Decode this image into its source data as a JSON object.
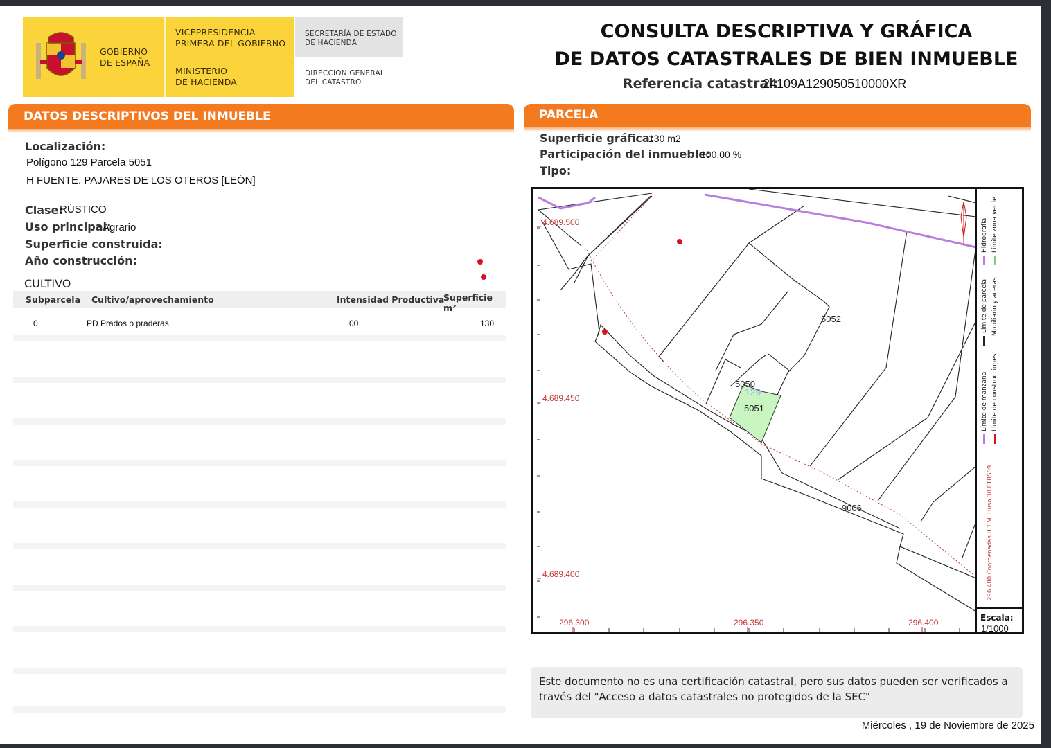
{
  "header": {
    "gov_line1": "GOBIERNO",
    "gov_line2": "DE ESPAÑA",
    "vice_line1": "VICEPRESIDENCIA",
    "vice_line2": "PRIMERA DEL GOBIERNO",
    "min_line1": "MINISTERIO",
    "min_line2": "DE HACIENDA",
    "sec_line1": "SECRETARÍA DE ESTADO",
    "sec_line2": "DE HACIENDA",
    "dir_line1": "DIRECCIÓN GENERAL",
    "dir_line2": "DEL CATASTRO"
  },
  "title": {
    "line1": "CONSULTA DESCRIPTIVA Y GRÁFICA",
    "line2": "DE DATOS CATASTRALES DE BIEN INMUEBLE",
    "ref_label": "Referencia catastral:",
    "ref_value": "24109A129050510000XR"
  },
  "left": {
    "header": "DATOS DESCRIPTIVOS DEL INMUEBLE",
    "localizacion_label": "Localización:",
    "localizacion_line1": "Polígono 129 Parcela 5051",
    "localizacion_line2": "H FUENTE. PAJARES DE LOS OTEROS [LEÓN]",
    "clase_label": "Clase:",
    "clase_value": "RÚSTICO",
    "uso_label": "Uso principal:",
    "uso_value": "Agrario",
    "superficie_label": "Superficie construida:",
    "anio_label": "Año construcción:",
    "cultivo_label": "CULTIVO"
  },
  "table": {
    "headers": [
      "Subparcela",
      "Cultivo/aprovechamiento",
      "Intensidad Productiva",
      "Superficie m²"
    ],
    "rows": [
      [
        "0",
        "PD Prados o praderas",
        "00",
        "130"
      ]
    ]
  },
  "right": {
    "header": "PARCELA",
    "sup_label": "Superficie gráfica:",
    "sup_value": "130 m2",
    "part_label": "Participación del inmueble:",
    "part_value": "100,00 %",
    "tipo_label": "Tipo:"
  },
  "map": {
    "y_labels": [
      "4.689.500",
      "4.689.450",
      "4.689.400"
    ],
    "x_labels": [
      "296.300",
      "296.350",
      "296.400"
    ],
    "parcels": [
      "5052",
      "5050",
      "129",
      "5051",
      "9006"
    ]
  },
  "legend": {
    "manzana": "Límite de manzana",
    "parcela": "Límite de parcela",
    "hidrografia": "Hidrografía",
    "construcciones": "Límite de construcciones",
    "mobiliario": "Mobiliario y aceras",
    "zona_verde": "Límite zona verde",
    "coords": "296.400 Coordenadas U.T.M. Huso 30 ETRS89",
    "escala_label": "Escala:",
    "escala_value": "1/1000"
  },
  "footer": {
    "notice": "Este documento no es una certificación catastral, pero sus datos pueden ser verificados a través del \"Acceso a datos catastrales no protegidos de la SEC\"",
    "date": "Miércoles , 19 de Noviembre de 2025"
  }
}
